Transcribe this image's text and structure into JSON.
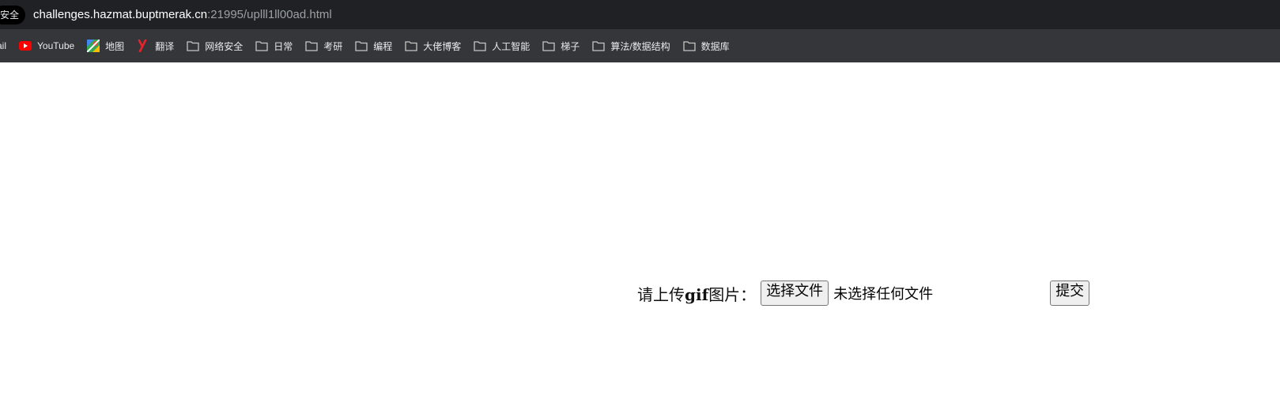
{
  "browser": {
    "security_chip": "安全",
    "url_host": "challenges.hazmat.buptmerak.cn",
    "url_rest": ":21995/uplll1ll00ad.html"
  },
  "bookmarks": [
    {
      "label": "ail",
      "icon": "gmail-icon"
    },
    {
      "label": "YouTube",
      "icon": "youtube-icon"
    },
    {
      "label": "地图",
      "icon": "maps-icon"
    },
    {
      "label": "翻译",
      "icon": "translate-icon"
    },
    {
      "label": "网络安全",
      "icon": "folder-icon"
    },
    {
      "label": "日常",
      "icon": "folder-icon"
    },
    {
      "label": "考研",
      "icon": "folder-icon"
    },
    {
      "label": "编程",
      "icon": "folder-icon"
    },
    {
      "label": "大佬博客",
      "icon": "folder-icon"
    },
    {
      "label": "人工智能",
      "icon": "folder-icon"
    },
    {
      "label": "梯子",
      "icon": "folder-icon"
    },
    {
      "label": "算法/数据结构",
      "icon": "folder-icon"
    },
    {
      "label": "数据库",
      "icon": "folder-icon"
    }
  ],
  "form": {
    "label_prefix": "请上传",
    "label_bold": "gif",
    "label_suffix": "图片：",
    "file_button": "选择文件",
    "file_status": "未选择任何文件",
    "submit": "提交"
  },
  "colors": {
    "toolbar": "#35363a",
    "addressbar": "#202124",
    "youtube_red": "#ff0000",
    "translate_red": "#e8232a"
  }
}
